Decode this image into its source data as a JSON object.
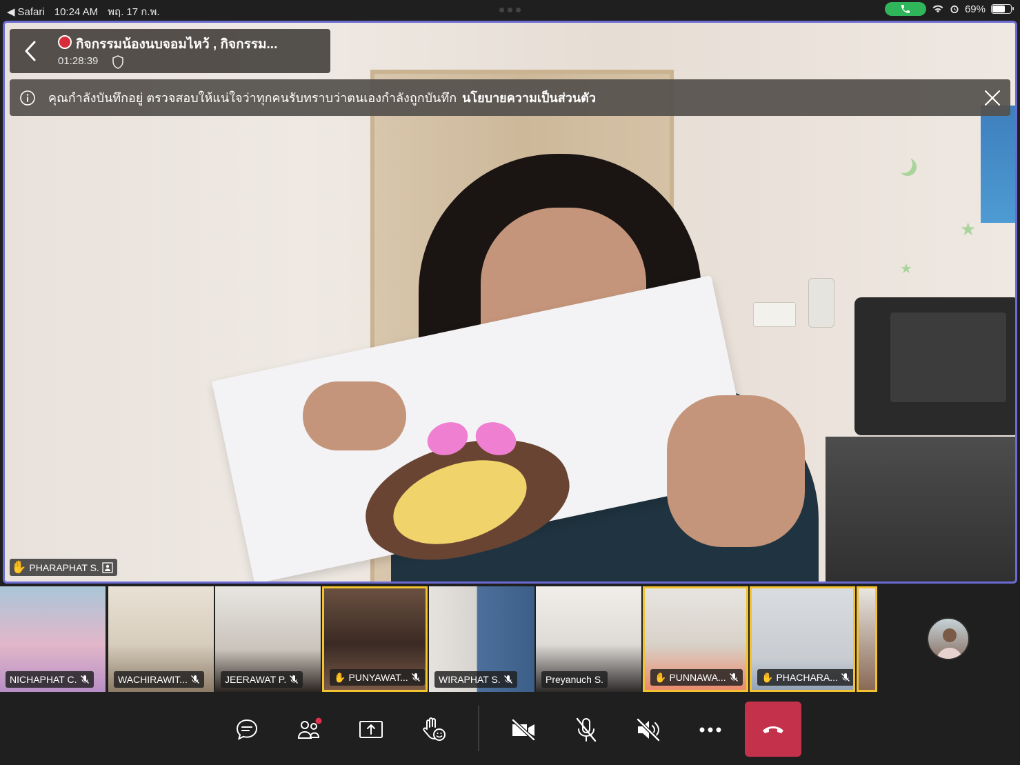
{
  "status_bar": {
    "back_app": "Safari",
    "time": "10:24 AM",
    "date": "พฤ. 17 ก.พ.",
    "battery": "69%",
    "battery_level": 0.69,
    "call_color": "#2fb55a"
  },
  "meeting": {
    "title": "กิจกรรมน้องนบจอมไหว้ , กิจกรรม...",
    "elapsed": "01:28:39",
    "recording_color": "#d92c3a"
  },
  "banner": {
    "message": "คุณกำลังบันทึกอยู่ ตรวจสอบให้แน่ใจว่าทุกคนรับทราบว่าตนเองกำลังถูกบันทึก",
    "link": "นโยบายความเป็นส่วนตัว"
  },
  "speaker": {
    "name": "PHARAPHAT S.",
    "hand_raised": true
  },
  "participants": [
    {
      "name": "NICHAPHAT C.",
      "hand_raised": false,
      "muted": true
    },
    {
      "name": "WACHIRAWIT...",
      "hand_raised": false,
      "muted": true
    },
    {
      "name": "JEERAWAT P.",
      "hand_raised": false,
      "muted": true
    },
    {
      "name": "PUNYAWAT...",
      "hand_raised": true,
      "muted": true
    },
    {
      "name": "WIRAPHAT S.",
      "hand_raised": false,
      "muted": true
    },
    {
      "name": "Preyanuch S.",
      "hand_raised": false,
      "muted": false
    },
    {
      "name": "PUNNAWA...",
      "hand_raised": true,
      "muted": true
    },
    {
      "name": "PHACHARA...",
      "hand_raised": true,
      "muted": true
    }
  ],
  "colors": {
    "active_border": "#6b6bd4",
    "raised_hand_border": "#f2c230",
    "hangup": "#c4314b",
    "hand": "#f2c230"
  },
  "controls": [
    {
      "name": "chat",
      "icon": "chat-icon"
    },
    {
      "name": "participants",
      "icon": "people-icon"
    },
    {
      "name": "share",
      "icon": "share-screen-icon"
    },
    {
      "name": "reactions",
      "icon": "raise-hand-icon"
    },
    {
      "name": "camera",
      "icon": "camera-off-icon"
    },
    {
      "name": "microphone",
      "icon": "mic-off-icon"
    },
    {
      "name": "speaker",
      "icon": "speaker-off-icon"
    },
    {
      "name": "more",
      "icon": "more-icon"
    },
    {
      "name": "hang-up",
      "icon": "hang-up-icon"
    }
  ]
}
